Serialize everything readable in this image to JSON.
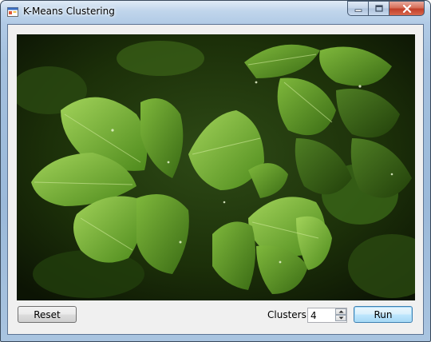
{
  "window": {
    "title": "K-Means Clustering"
  },
  "controls": {
    "reset_label": "Reset",
    "clusters_label": "Clusters:",
    "clusters_value": "4",
    "run_label": "Run"
  },
  "image": {
    "subject": "green-leaves-photo"
  },
  "icons": {
    "app": "app-icon",
    "minimize": "minimize-icon",
    "maximize": "maximize-icon",
    "close": "close-icon",
    "spin_up": "chevron-up-icon",
    "spin_down": "chevron-down-icon"
  },
  "colors": {
    "run_button_border": "#3c7fb1",
    "close_button": "#c2402a",
    "client_background": "#f0f0f0"
  }
}
